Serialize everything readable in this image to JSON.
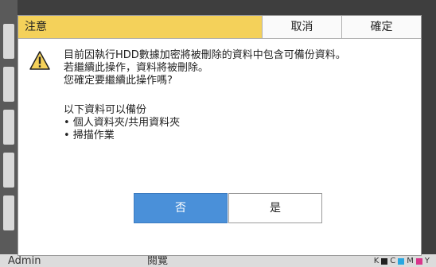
{
  "background": {
    "user_label": "Admin",
    "mid_label": "閱覽",
    "status_letters": [
      "K",
      "C",
      "M",
      "Y"
    ]
  },
  "dialog": {
    "title": "注意",
    "cancel_label": "取消",
    "confirm_label": "確定",
    "message_lines": [
      "目前因執行HDD數據加密將被刪除的資料中包含可備份資料。",
      "若繼續此操作，資料將被刪除。",
      "您確定要繼續此操作嗎?"
    ],
    "backup_title": "以下資料可以備份",
    "backup_items": [
      "• 個人資料夾/共用資料夾",
      "• 掃描作業"
    ],
    "no_label": "否",
    "yes_label": "是",
    "icon": "warning-icon"
  },
  "colors": {
    "title_bar": "#f4d15a",
    "primary_button": "#4a90d9",
    "backdrop": "#3e3e3e"
  }
}
